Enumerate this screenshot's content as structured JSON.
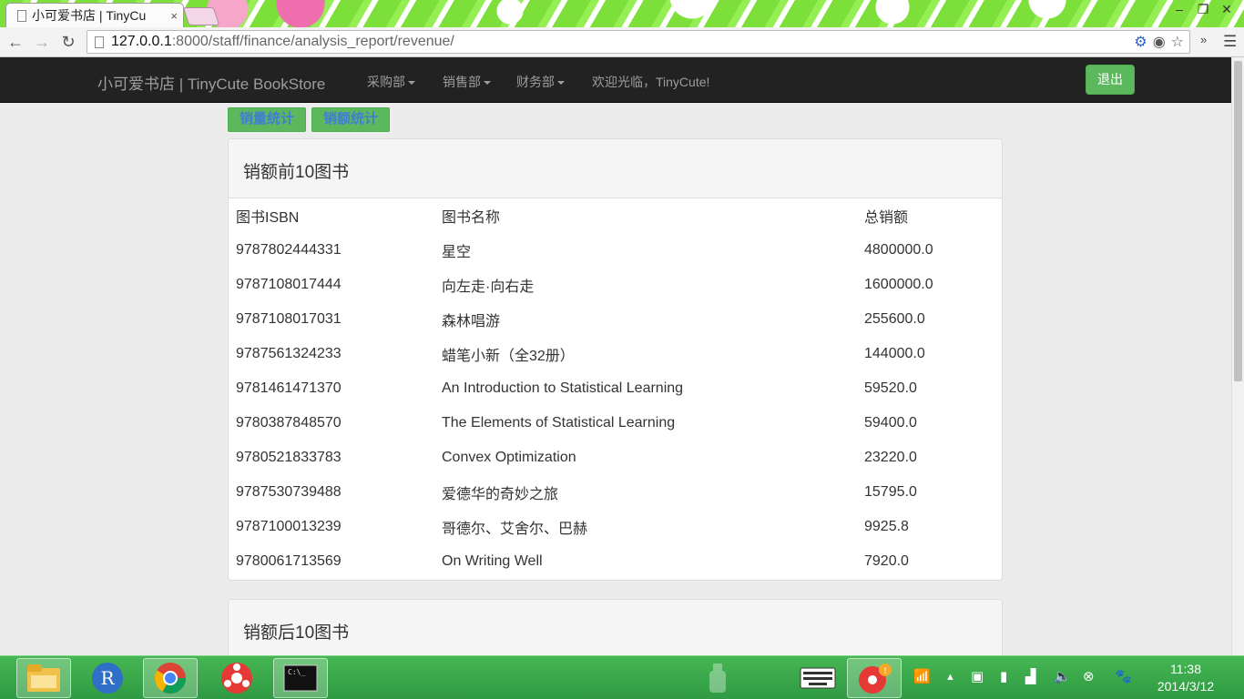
{
  "browser": {
    "tab_title": "小可爱书店 | TinyCu",
    "tab_close": "×",
    "url_host": "127.0.0.1",
    "url_rest": ":8000/staff/finance/analysis_report/revenue/",
    "window_min": "‒",
    "window_max": "❐",
    "window_close": "✕"
  },
  "navbar": {
    "brand": "小可爱书店 | TinyCute BookStore",
    "menus": [
      "采购部",
      "销售部",
      "财务部"
    ],
    "welcome": "欢迎光临，TinyCute!",
    "logout": "退出"
  },
  "buttons": {
    "sales_volume": "销量统计",
    "sales_revenue": "销额统计"
  },
  "top10": {
    "title": "销额前10图书",
    "headers": [
      "图书ISBN",
      "图书名称",
      "总销额"
    ],
    "rows": [
      [
        "9787802444331",
        "星空",
        "4800000.0"
      ],
      [
        "9787108017444",
        "向左走·向右走",
        "1600000.0"
      ],
      [
        "9787108017031",
        "森林唱游",
        "255600.0"
      ],
      [
        "9787561324233",
        "蜡笔小新（全32册）",
        "144000.0"
      ],
      [
        "9781461471370",
        "An Introduction to Statistical Learning",
        "59520.0"
      ],
      [
        "9780387848570",
        "The Elements of Statistical Learning",
        "59400.0"
      ],
      [
        "9780521833783",
        "Convex Optimization",
        "23220.0"
      ],
      [
        "9787530739488",
        "爱德华的奇妙之旅",
        "15795.0"
      ],
      [
        "9787100013239",
        "哥德尔、艾舍尔、巴赫",
        "9925.8"
      ],
      [
        "9780061713569",
        "On Writing Well",
        "7920.0"
      ]
    ]
  },
  "bottom10": {
    "title": "销额后10图书"
  },
  "taskbar": {
    "time": "11:38",
    "date": "2014/3/12"
  }
}
